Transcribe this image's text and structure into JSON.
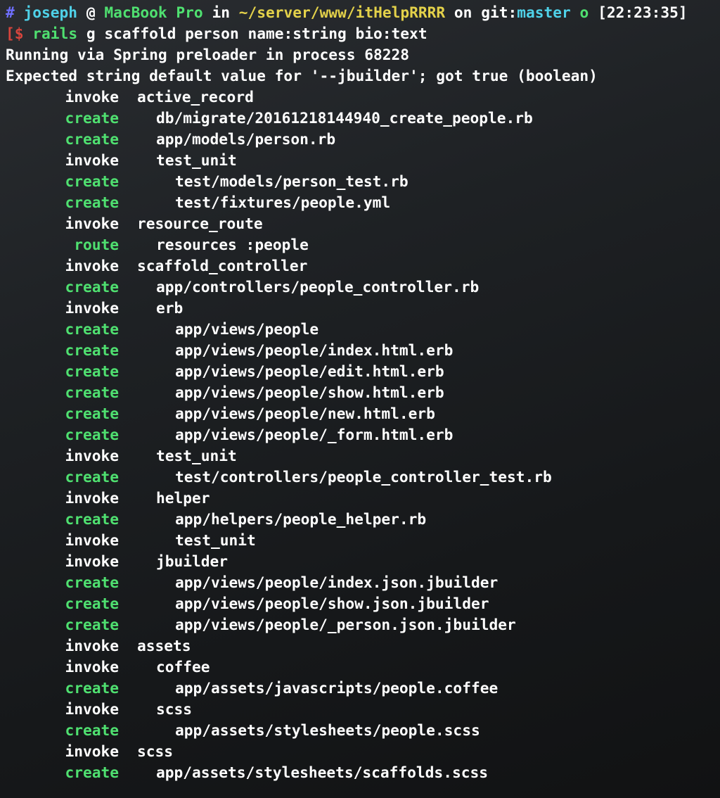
{
  "prompt": {
    "hash": "#",
    "user": "joseph",
    "at": "@",
    "host": "MacBook Pro",
    "in": "in",
    "path": "~/server/www/itHelpRRRR",
    "on": "on",
    "git_label": "git:",
    "branch": "master",
    "dirty": "o",
    "time": "[22:23:35]",
    "dollar_prefix": "[",
    "dollar": "$",
    "command": "rails",
    "command_args": "g scaffold person name:string bio:text"
  },
  "output_lines": [
    "Running via Spring preloader in process 68228",
    "Expected string default value for '--jbuilder'; got true (boolean)"
  ],
  "generator_lines": [
    {
      "verb": "invoke",
      "level": 0,
      "text": "active_record"
    },
    {
      "verb": "create",
      "level": 1,
      "text": "db/migrate/20161218144940_create_people.rb"
    },
    {
      "verb": "create",
      "level": 1,
      "text": "app/models/person.rb"
    },
    {
      "verb": "invoke",
      "level": 1,
      "text": "test_unit"
    },
    {
      "verb": "create",
      "level": 2,
      "text": "test/models/person_test.rb"
    },
    {
      "verb": "create",
      "level": 2,
      "text": "test/fixtures/people.yml"
    },
    {
      "verb": "invoke",
      "level": 0,
      "text": "resource_route"
    },
    {
      "verb": "route",
      "level": 1,
      "text": "resources :people"
    },
    {
      "verb": "invoke",
      "level": 0,
      "text": "scaffold_controller"
    },
    {
      "verb": "create",
      "level": 1,
      "text": "app/controllers/people_controller.rb"
    },
    {
      "verb": "invoke",
      "level": 1,
      "text": "erb"
    },
    {
      "verb": "create",
      "level": 2,
      "text": "app/views/people"
    },
    {
      "verb": "create",
      "level": 2,
      "text": "app/views/people/index.html.erb"
    },
    {
      "verb": "create",
      "level": 2,
      "text": "app/views/people/edit.html.erb"
    },
    {
      "verb": "create",
      "level": 2,
      "text": "app/views/people/show.html.erb"
    },
    {
      "verb": "create",
      "level": 2,
      "text": "app/views/people/new.html.erb"
    },
    {
      "verb": "create",
      "level": 2,
      "text": "app/views/people/_form.html.erb"
    },
    {
      "verb": "invoke",
      "level": 1,
      "text": "test_unit"
    },
    {
      "verb": "create",
      "level": 2,
      "text": "test/controllers/people_controller_test.rb"
    },
    {
      "verb": "invoke",
      "level": 1,
      "text": "helper"
    },
    {
      "verb": "create",
      "level": 2,
      "text": "app/helpers/people_helper.rb"
    },
    {
      "verb": "invoke",
      "level": 2,
      "text": "test_unit"
    },
    {
      "verb": "invoke",
      "level": 1,
      "text": "jbuilder"
    },
    {
      "verb": "create",
      "level": 2,
      "text": "app/views/people/index.json.jbuilder"
    },
    {
      "verb": "create",
      "level": 2,
      "text": "app/views/people/show.json.jbuilder"
    },
    {
      "verb": "create",
      "level": 2,
      "text": "app/views/people/_person.json.jbuilder"
    },
    {
      "verb": "invoke",
      "level": 0,
      "text": "assets"
    },
    {
      "verb": "invoke",
      "level": 1,
      "text": "coffee"
    },
    {
      "verb": "create",
      "level": 2,
      "text": "app/assets/javascripts/people.coffee"
    },
    {
      "verb": "invoke",
      "level": 1,
      "text": "scss"
    },
    {
      "verb": "create",
      "level": 2,
      "text": "app/assets/stylesheets/people.scss"
    },
    {
      "verb": "invoke",
      "level": 0,
      "text": "scss"
    },
    {
      "verb": "create",
      "level": 1,
      "text": "app/assets/stylesheets/scaffolds.scss"
    }
  ],
  "colors": {
    "background": "#1e2124",
    "hash": "#6f6fff",
    "user": "#4fd1e8",
    "host": "#4fe070",
    "path": "#e3d14a",
    "create_verb": "#4fe070",
    "invoke_verb": "#ffffff",
    "dollar": "#d6453d"
  }
}
